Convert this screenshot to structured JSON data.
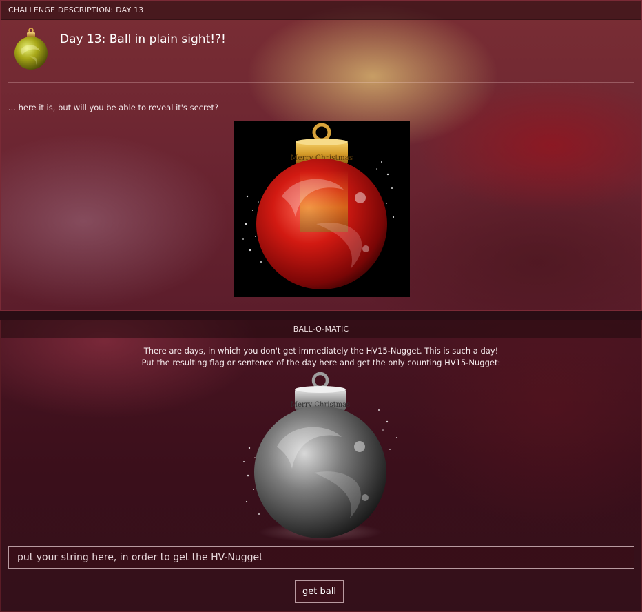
{
  "challenge": {
    "header": "CHALLENGE DESCRIPTION: DAY 13",
    "title": "Day 13: Ball in plain sight!?!",
    "intro": "... here it is, but will you be able to reveal it's secret?",
    "image_cap_text": "Merry Christmas",
    "icon": "gold-ornament-icon"
  },
  "ball_o_matic": {
    "header": "BALL-O-MATIC",
    "description_line1": "There are days, in which you don't get immediately the HV15-Nugget. This is such a day!",
    "description_line2": "Put the resulting flag or sentence of the day here and get the only counting HV15-Nugget:",
    "ornament_cap_text": "Merry Christmas",
    "input": {
      "placeholder": "put your string here, in order to get the HV-Nugget",
      "value": ""
    },
    "button_label": "get ball"
  },
  "colors": {
    "accent_red": "#c2151a",
    "gold": "#c9a227",
    "silver": "#8f8f8f",
    "panel_bg": "#6d2632"
  }
}
